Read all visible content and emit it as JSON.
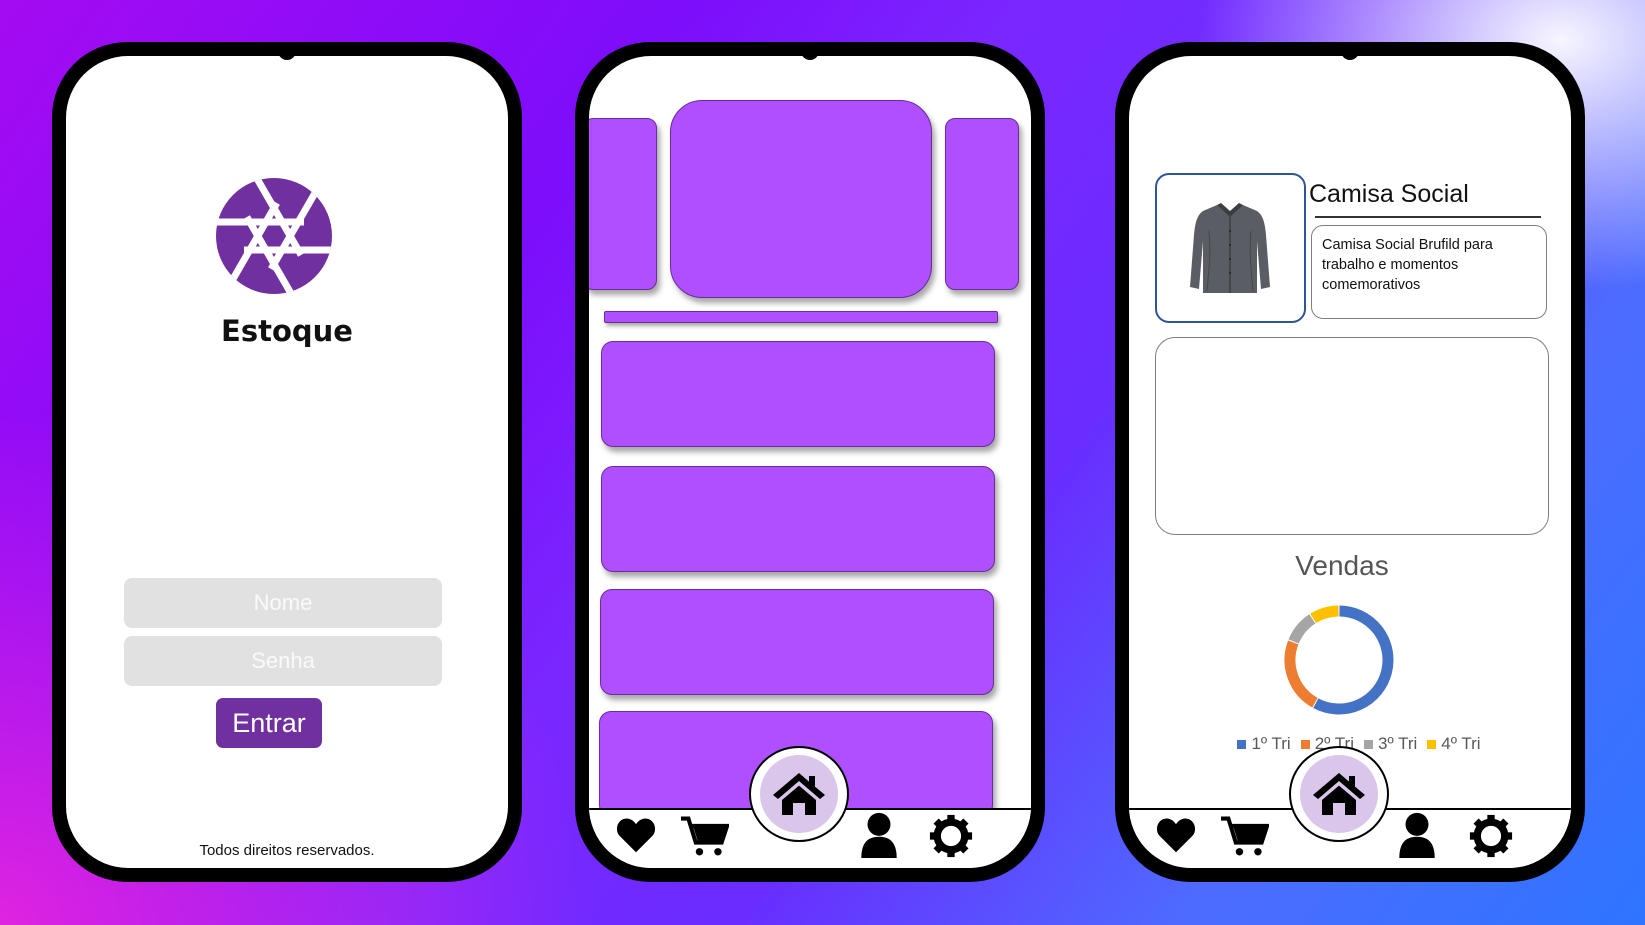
{
  "login": {
    "app_name": "Estoque",
    "name_placeholder": "Nome",
    "password_placeholder": "Senha",
    "enter_label": "Entrar",
    "footer": "Todos direitos reservados.",
    "logo_icon": "aperture-icon",
    "accent_color": "#7030a0"
  },
  "home": {
    "card_color": "#b04fff",
    "nav": [
      "heart-icon",
      "cart-icon",
      "home-icon",
      "user-icon",
      "gear-icon"
    ]
  },
  "product": {
    "title": "Camisa Social",
    "description": "Camisa Social Brufild para trabalho e momentos comemorativos",
    "image_icon": "shirt-icon"
  },
  "chart_data": {
    "type": "pie",
    "title": "Vendas",
    "categories": [
      "1º Tri",
      "2º Tri",
      "3º Tri",
      "4º Tri"
    ],
    "values": [
      58,
      23,
      10,
      9
    ],
    "colors": [
      "#4472c4",
      "#ed7d31",
      "#a5a5a5",
      "#ffc000"
    ],
    "legend_position": "bottom"
  }
}
